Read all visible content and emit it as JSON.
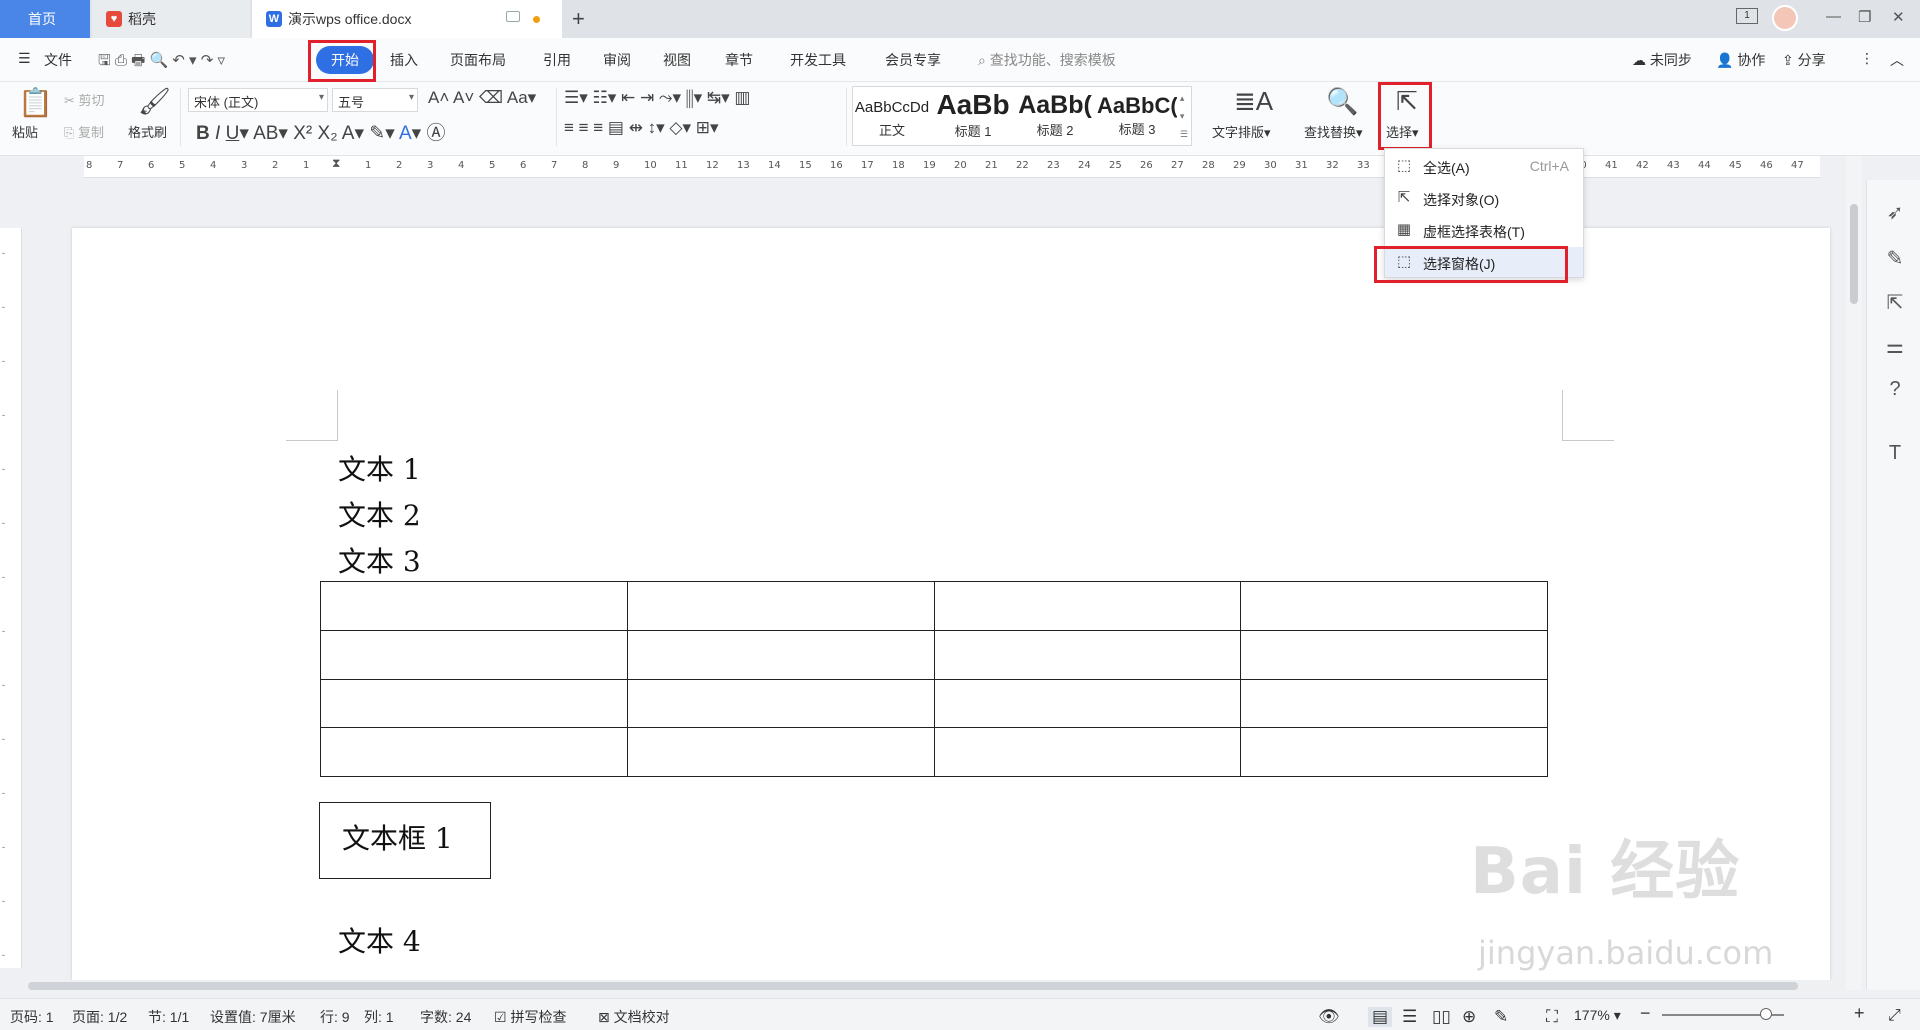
{
  "tabs": {
    "home": "首页",
    "daoke": "稻壳",
    "doc": "演示wps office.docx"
  },
  "menubar": {
    "file": "文件",
    "items": [
      "开始",
      "插入",
      "页面布局",
      "引用",
      "审阅",
      "视图",
      "章节",
      "开发工具",
      "会员专享"
    ],
    "search_placeholder": "查找功能、搜索模板",
    "sync": "未同步",
    "collab": "协作",
    "share": "分享"
  },
  "ribbon": {
    "cut": "剪切",
    "copy": "复制",
    "paste": "粘贴",
    "format_painter": "格式刷",
    "font": "宋体 (正文)",
    "size": "五号",
    "styles": [
      {
        "preview": "AaBbCcDd",
        "name": "正文"
      },
      {
        "preview": "AaBb",
        "name": "标题 1"
      },
      {
        "preview": "AaBb(",
        "name": "标题 2"
      },
      {
        "preview": "AaBbC(",
        "name": "标题 3"
      }
    ],
    "text_layout": "文字排版",
    "find_replace": "查找替换",
    "select": "选择"
  },
  "ruler": {
    "ticks": [
      "8",
      "7",
      "6",
      "5",
      "4",
      "3",
      "2",
      "1",
      "",
      "1",
      "2",
      "3",
      "4",
      "5",
      "6",
      "7",
      "8",
      "9",
      "10",
      "11",
      "12",
      "13",
      "14",
      "15",
      "16",
      "17",
      "18",
      "19",
      "20",
      "21",
      "22",
      "23",
      "24",
      "25",
      "26",
      "27",
      "28",
      "29",
      "30",
      "31",
      "32",
      "33",
      "34",
      "35",
      "36",
      "37",
      "38",
      "39",
      "40",
      "41",
      "42",
      "43",
      "44",
      "45",
      "46",
      "47"
    ]
  },
  "document": {
    "lines": [
      "文本 1",
      "文本 2",
      "文本 3"
    ],
    "textbox": "文本框 1",
    "line4": "文本 4",
    "table_rows": 4,
    "table_cols": 4
  },
  "select_menu": {
    "items": [
      {
        "label": "全选(A)",
        "shortcut": "Ctrl+A",
        "icon": "select-all-icon"
      },
      {
        "label": "选择对象(O)",
        "shortcut": "",
        "icon": "pointer-icon"
      },
      {
        "label": "虚框选择表格(T)",
        "shortcut": "",
        "icon": "table-select-icon"
      },
      {
        "label": "选择窗格(J)",
        "shortcut": "",
        "icon": "selection-pane-icon"
      }
    ]
  },
  "statusbar": {
    "page_code": "页码: 1",
    "page": "页面: 1/2",
    "section": "节: 1/1",
    "setting": "设置值: 7厘米",
    "row": "行: 9",
    "col": "列: 1",
    "words": "字数: 24",
    "spell_check": "拼写检查",
    "doc_proof": "文档校对",
    "zoom": "177%"
  },
  "watermark": {
    "line1": "Bai 经验",
    "line2": "jingyan.baidu.com"
  },
  "colors": {
    "accent": "#2f6fe4",
    "highlight": "#e0202a"
  }
}
